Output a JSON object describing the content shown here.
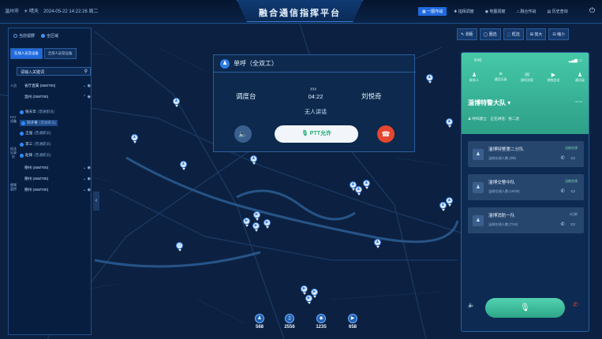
{
  "header": {
    "city": "温州市",
    "weather": "☀ 晴天",
    "datetime": "2024-05-22 14:22:26 周二",
    "title": "融合通信指挥平台",
    "nav": [
      "一图作战",
      "指挥调度",
      "地图调度",
      "融合作战",
      "历史查询"
    ],
    "nav_icons": [
      "grid-icon",
      "command-icon",
      "location-icon",
      "combat-icon",
      "history-icon"
    ],
    "power_glyph": "⏻"
  },
  "left": {
    "scope_options": [
      "当前视野",
      "全区域"
    ],
    "tabs": [
      "在线人员及设备",
      "全部人员及设备"
    ],
    "search_placeholder": "请输入关键词",
    "vtabs": [
      "人员",
      "PDT设备",
      "执法记录仪",
      "视频监控"
    ],
    "groups": [
      {
        "name": "省厅直属 (658/700)"
      },
      {
        "name": "温州 (258/700)"
      }
    ],
    "members": [
      {
        "name": "张天华",
        "tag": "(普通职员)"
      },
      {
        "name": "刘子奇",
        "tag": "(普通职员)"
      },
      {
        "name": "王强",
        "tag": "(普通职员)"
      },
      {
        "name": "李三",
        "tag": "(普通职员)"
      },
      {
        "name": "赵辉",
        "tag": "(普通职员)"
      }
    ],
    "more_groups": [
      {
        "name": "德州 (458/700)"
      },
      {
        "name": "德州 (458/700)"
      },
      {
        "name": "德州 (458/700)"
      }
    ],
    "collapse_glyph": "‹"
  },
  "tools": [
    "测距",
    "圈选",
    "框选",
    "放大",
    "缩小"
  ],
  "call": {
    "mode": "单呼（全双工）",
    "from": "调度台",
    "to": "刘悦奇",
    "arrows": "›››",
    "timer": "04:22",
    "status": "无人讲话",
    "ptt_label": "🎙 PTT允许",
    "vol_glyph": "🔈",
    "hang_glyph": "☎"
  },
  "stats": [
    {
      "icon": "person-icon",
      "glyph": "♟",
      "value": "568"
    },
    {
      "icon": "handset-icon",
      "glyph": "▯",
      "value": "2556"
    },
    {
      "icon": "camera-icon",
      "glyph": "◉",
      "value": "1235"
    },
    {
      "icon": "video-icon",
      "glyph": "▶",
      "value": "658"
    }
  ],
  "phone": {
    "time": "9:41",
    "signal": "▂▄▆ ▭",
    "nav": [
      {
        "g": "♟",
        "label": "联系人"
      },
      {
        "g": "≡",
        "label": "通话记录"
      },
      {
        "g": "✉",
        "label": "即时消息"
      },
      {
        "g": "▶",
        "label": "视频会议"
      },
      {
        "g": "♟",
        "label": "通讯录"
      }
    ],
    "team": "淄博特警大队 ▾",
    "status": "呼叫建立　正在讲话：张二虎",
    "cards": [
      {
        "name": "淄博特警第二分队",
        "sub": "当前在线人数 (3/9)",
        "state": "当前在线",
        "online": true
      },
      {
        "name": "淄博交警中队",
        "sub": "当前在线人数 (10/20)",
        "state": "当前在线",
        "online": true
      },
      {
        "name": "淄博消防一队",
        "sub": "当前在线人数 (7/15)",
        "state": "5日前",
        "online": false
      }
    ],
    "card_actions": "✆ ▭",
    "spk_glyph": "🔈",
    "mic_glyph": "🎙",
    "end_glyph": "✆"
  }
}
